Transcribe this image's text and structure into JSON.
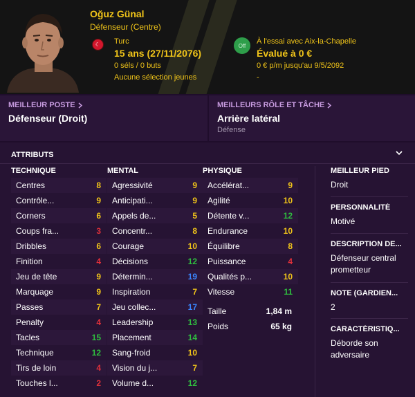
{
  "player": {
    "name": "Oğuz Günal",
    "position": "Défenseur (Centre)",
    "nationality": "Turc",
    "age": "15 ans (27/11/2076)",
    "caps": "0 séls / 0 buts",
    "youth": "Aucune sélection jeunes",
    "off_badge": "Off",
    "trial": "À l'essai avec Aix-la-Chapelle",
    "value": "Évalué à 0 €",
    "wage": "0 € p/m jusqu'au 9/5/2092",
    "dash": "-"
  },
  "best_position": {
    "title": "MEILLEUR POSTE",
    "value": "Défenseur (Droit)"
  },
  "best_role": {
    "title": "MEILLEURS RÔLE ET TÂCHE",
    "value": "Arrière latéral",
    "sub": "Défense"
  },
  "attributes": {
    "title": "ATTRIBUTS",
    "technique": {
      "header": "TECHNIQUE",
      "items": [
        {
          "label": "Centres",
          "value": "8"
        },
        {
          "label": "Contrôle...",
          "value": "9"
        },
        {
          "label": "Corners",
          "value": "6"
        },
        {
          "label": "Coups fra...",
          "value": "3"
        },
        {
          "label": "Dribbles",
          "value": "6"
        },
        {
          "label": "Finition",
          "value": "4"
        },
        {
          "label": "Jeu de tête",
          "value": "9"
        },
        {
          "label": "Marquage",
          "value": "9"
        },
        {
          "label": "Passes",
          "value": "7"
        },
        {
          "label": "Penalty",
          "value": "4"
        },
        {
          "label": "Tacles",
          "value": "15"
        },
        {
          "label": "Technique",
          "value": "12"
        },
        {
          "label": "Tirs de loin",
          "value": "4"
        },
        {
          "label": "Touches l...",
          "value": "2"
        }
      ]
    },
    "mental": {
      "header": "MENTAL",
      "items": [
        {
          "label": "Agressivité",
          "value": "9"
        },
        {
          "label": "Anticipati...",
          "value": "9"
        },
        {
          "label": "Appels de...",
          "value": "5"
        },
        {
          "label": "Concentr...",
          "value": "8"
        },
        {
          "label": "Courage",
          "value": "10"
        },
        {
          "label": "Décisions",
          "value": "12"
        },
        {
          "label": "Détermin...",
          "value": "19"
        },
        {
          "label": "Inspiration",
          "value": "7"
        },
        {
          "label": "Jeu collec...",
          "value": "17"
        },
        {
          "label": "Leadership",
          "value": "13"
        },
        {
          "label": "Placement",
          "value": "14"
        },
        {
          "label": "Sang-froid",
          "value": "10"
        },
        {
          "label": "Vision du j...",
          "value": "7"
        },
        {
          "label": "Volume d...",
          "value": "12"
        }
      ]
    },
    "physique": {
      "header": "PHYSIQUE",
      "items": [
        {
          "label": "Accélérat...",
          "value": "9"
        },
        {
          "label": "Agilité",
          "value": "10"
        },
        {
          "label": "Détente v...",
          "value": "12"
        },
        {
          "label": "Endurance",
          "value": "10"
        },
        {
          "label": "Équilibre",
          "value": "8"
        },
        {
          "label": "Puissance",
          "value": "4"
        },
        {
          "label": "Qualités p...",
          "value": "10"
        },
        {
          "label": "Vitesse",
          "value": "11"
        }
      ]
    },
    "height": {
      "label": "Taille",
      "value": "1,84 m"
    },
    "weight": {
      "label": "Poids",
      "value": "65 kg"
    }
  },
  "info": {
    "foot": {
      "title": "MEILLEUR PIED",
      "value": "Droit"
    },
    "personality": {
      "title": "PERSONNALITÉ",
      "value": "Motivé"
    },
    "description": {
      "title": "DESCRIPTION DE...",
      "value": "Défenseur central prometteur"
    },
    "note": {
      "title": "NOTE (GARDIEN...",
      "value": "2"
    },
    "trait": {
      "title": "CARACTÉRISTIQ...",
      "value": "Déborde son adversaire"
    }
  },
  "colors": {
    "accent": "#f0c419",
    "rating_low": "#e0303a",
    "rating_mid": "#f0c419",
    "rating_good": "#f0c419",
    "rating_high": "#2fbf3f",
    "rating_top": "#3a86ff",
    "link_purple": "#c89ce0"
  }
}
